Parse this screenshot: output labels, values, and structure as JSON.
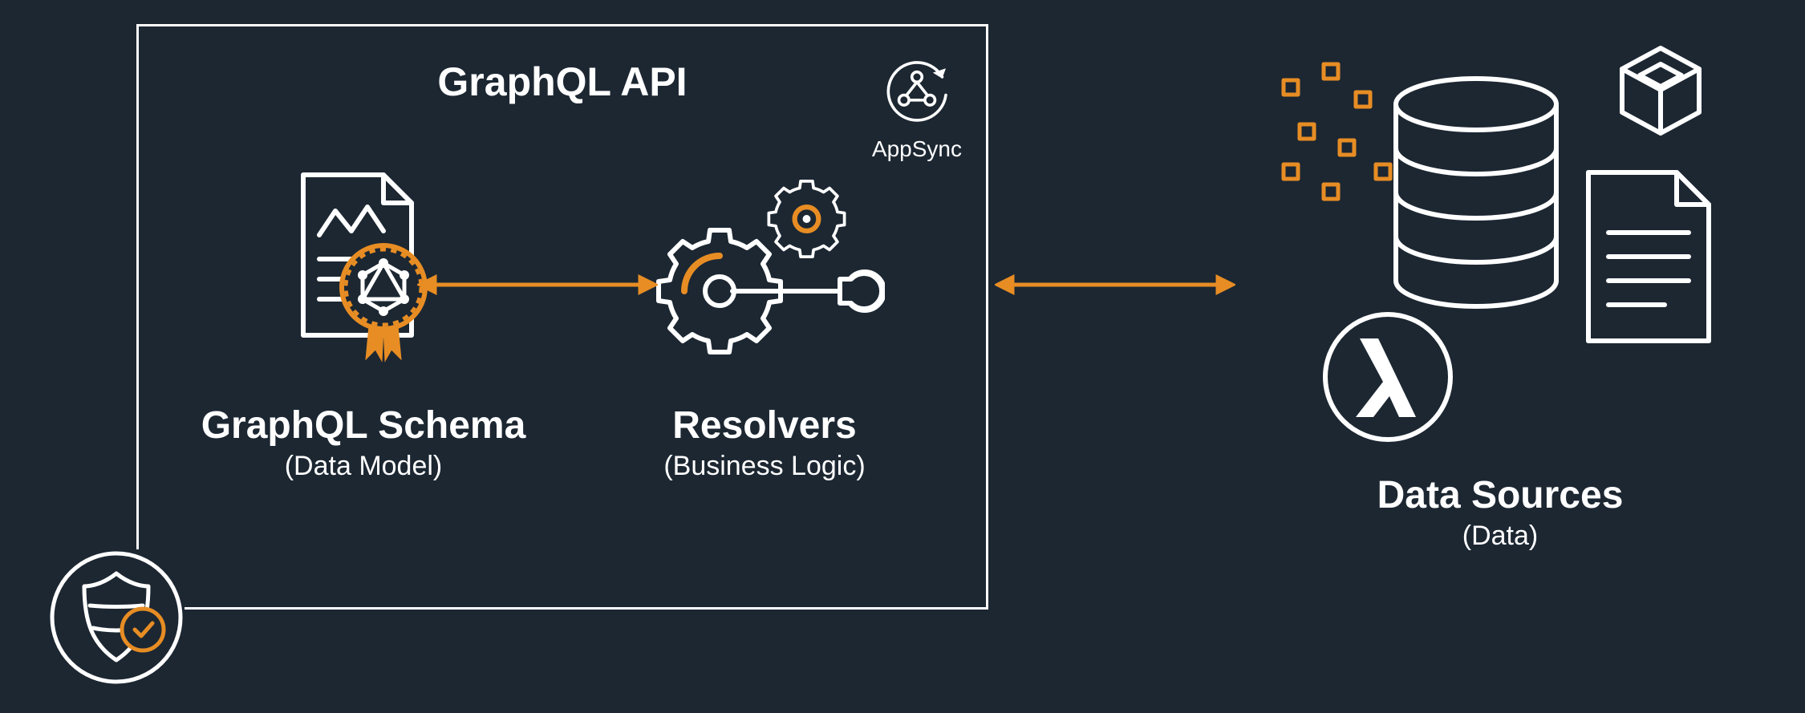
{
  "api": {
    "title": "GraphQL API",
    "appsync_label": "AppSync"
  },
  "schema": {
    "title": "GraphQL Schema",
    "subtitle": "(Data Model)"
  },
  "resolvers": {
    "title": "Resolvers",
    "subtitle": "(Business Logic)"
  },
  "data_sources": {
    "title": "Data Sources",
    "subtitle": "(Data)"
  },
  "colors": {
    "bg": "#1c2732",
    "fg": "#ffffff",
    "accent": "#e78d24"
  },
  "chart_data": {
    "type": "diagram",
    "title": "GraphQL API architecture (AWS AppSync)",
    "nodes": [
      {
        "id": "security",
        "label": "Security / Auth",
        "type": "badge"
      },
      {
        "id": "api",
        "label": "GraphQL API",
        "type": "container",
        "service": "AppSync"
      },
      {
        "id": "schema",
        "label": "GraphQL Schema",
        "subtitle": "Data Model",
        "parent": "api"
      },
      {
        "id": "resolvers",
        "label": "Resolvers",
        "subtitle": "Business Logic",
        "parent": "api"
      },
      {
        "id": "data_sources",
        "label": "Data Sources",
        "subtitle": "Data",
        "examples": [
          "Database",
          "Document",
          "Lambda",
          "Other AWS services"
        ]
      }
    ],
    "edges": [
      {
        "from": "schema",
        "to": "resolvers",
        "bidirectional": true
      },
      {
        "from": "resolvers",
        "to": "data_sources",
        "bidirectional": true
      }
    ]
  }
}
